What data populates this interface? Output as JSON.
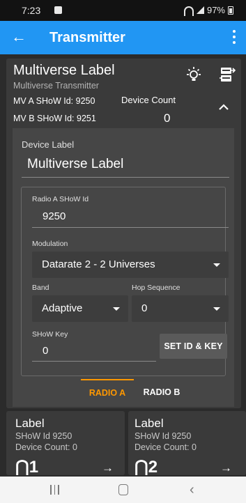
{
  "status_bar": {
    "time": "7:23",
    "battery": "97%"
  },
  "app_bar": {
    "title": "Transmitter",
    "back_icon": "arrow-left-icon",
    "menu_icon": "more-vert-icon",
    "color": "#2196f3"
  },
  "transmitter_card": {
    "name": "Multiverse Label",
    "subtitle": "Multiverse Transmitter",
    "mv_a": "MV A SHoW Id: 9250",
    "mv_b": "MV B SHoW Id: 9251",
    "device_count_label": "Device Count",
    "device_count_value": "0",
    "icons": [
      "lightbulb-icon",
      "rdm-icon",
      "chevron-up-icon"
    ]
  },
  "settings": {
    "device_label_label": "Device Label",
    "device_label_value": "Multiverse Label",
    "show_id_label": "Radio A SHoW Id",
    "show_id_value": "9250",
    "modulation_label": "Modulation",
    "modulation_value": "Datarate 2 - 2 Universes",
    "band_label": "Band",
    "band_value": "Adaptive",
    "hop_label": "Hop Sequence",
    "hop_value": "0",
    "show_key_label": "SHoW Key",
    "show_key_value": "0",
    "set_button": "SET ID & KEY"
  },
  "tabs": {
    "radio_a": "RADIO A",
    "radio_b": "RADIO B",
    "active": "RADIO A",
    "accent": "#ff9800"
  },
  "universes": [
    {
      "label": "Label",
      "show_id": "SHoW Id 9250",
      "device_count": "Device Count: 0",
      "number": "1"
    },
    {
      "label": "Label",
      "show_id": "SHoW Id 9250",
      "device_count": "Device Count: 0",
      "number": "2"
    }
  ],
  "nav_bar": {
    "icons": [
      "recents-icon",
      "home-icon",
      "back-nav-icon"
    ]
  }
}
